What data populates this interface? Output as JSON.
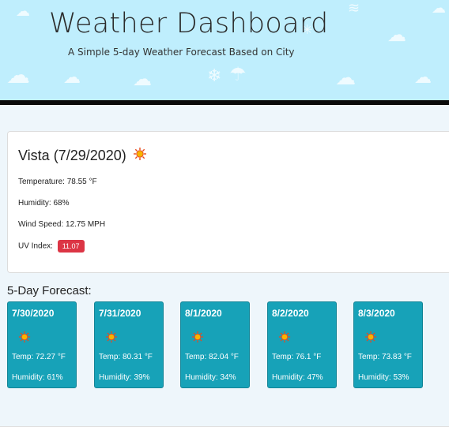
{
  "header": {
    "title": "Weather Dashboard",
    "subtitle": "A Simple 5-day Weather Forecast Based on City",
    "background_color": "#bfeefd"
  },
  "current": {
    "city_heading": "Vista (7/29/2020)",
    "icon": "sun-icon",
    "temperature": "Temperature: 78.55 °F",
    "humidity": "Humidity: 68%",
    "wind": "Wind Speed: 12.75 MPH",
    "uv_label": "UV Index:",
    "uv_value": "11.07",
    "uv_color": "#dc3545"
  },
  "forecast": {
    "heading": "5-Day Forecast:",
    "card_color": "#17a2b8",
    "days": [
      {
        "date": "7/30/2020",
        "icon": "sun-icon",
        "temp": "Temp: 72.27 °F",
        "humidity": "Humidity: 61%"
      },
      {
        "date": "7/31/2020",
        "icon": "sun-icon",
        "temp": "Temp: 80.31 °F",
        "humidity": "Humidity: 39%"
      },
      {
        "date": "8/1/2020",
        "icon": "sun-icon",
        "temp": "Temp: 82.04 °F",
        "humidity": "Humidity: 34%"
      },
      {
        "date": "8/2/2020",
        "icon": "sun-icon",
        "temp": "Temp: 76.1 °F",
        "humidity": "Humidity: 47%"
      },
      {
        "date": "8/3/2020",
        "icon": "sun-icon",
        "temp": "Temp: 73.83 °F",
        "humidity": "Humidity: 53%"
      }
    ]
  }
}
